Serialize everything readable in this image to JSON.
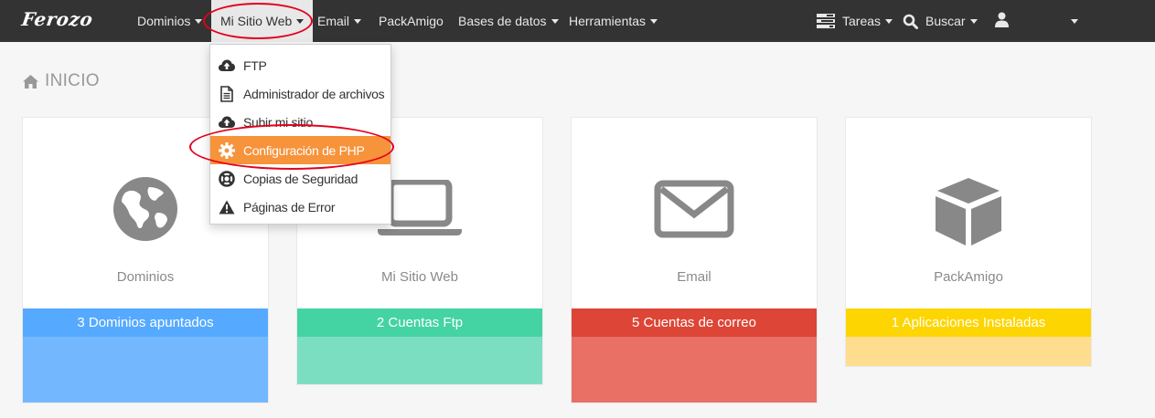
{
  "brand": "Ferozo",
  "nav": {
    "items": [
      {
        "label": "Dominios"
      },
      {
        "label": "Mi Sitio Web"
      },
      {
        "label": "Email"
      },
      {
        "label": "PackAmigo"
      },
      {
        "label": "Bases de datos"
      },
      {
        "label": "Herramientas"
      }
    ],
    "tasks": "Tareas",
    "search": "Buscar"
  },
  "page": {
    "title": "INICIO"
  },
  "dropdown": {
    "items": [
      {
        "label": "FTP",
        "icon": "cloud-upload-icon"
      },
      {
        "label": "Administrador de archivos",
        "icon": "file-icon"
      },
      {
        "label": "Subir mi sitio",
        "icon": "cloud-upload-icon"
      },
      {
        "label": "Configuración de PHP",
        "icon": "gear-icon"
      },
      {
        "label": "Copias de Seguridad",
        "icon": "lifebuoy-icon"
      },
      {
        "label": "Páginas de Error",
        "icon": "warning-icon"
      }
    ]
  },
  "cards": [
    {
      "title": "Dominios",
      "summary": "3 Dominios apuntados",
      "icon": "globe-icon",
      "bar_color": "#55aaff",
      "fill_color": "#73b8ff"
    },
    {
      "title": "Mi Sitio Web",
      "summary": "2 Cuentas Ftp",
      "icon": "laptop-icon",
      "bar_color": "#44d3a3",
      "fill_color": "#7cdec0"
    },
    {
      "title": "Email",
      "summary": "5 Cuentas de correo",
      "icon": "envelope-icon",
      "bar_color": "#dd4536",
      "fill_color": "#e87065"
    },
    {
      "title": "PackAmigo",
      "summary": "1 Aplicaciones Instaladas",
      "icon": "cube-icon",
      "bar_color": "#fdd500",
      "fill_color": "#ffdd8f"
    }
  ],
  "colors": {
    "navbar": "#333333",
    "highlight": "#f7933b",
    "annotation": "#e3001b"
  }
}
